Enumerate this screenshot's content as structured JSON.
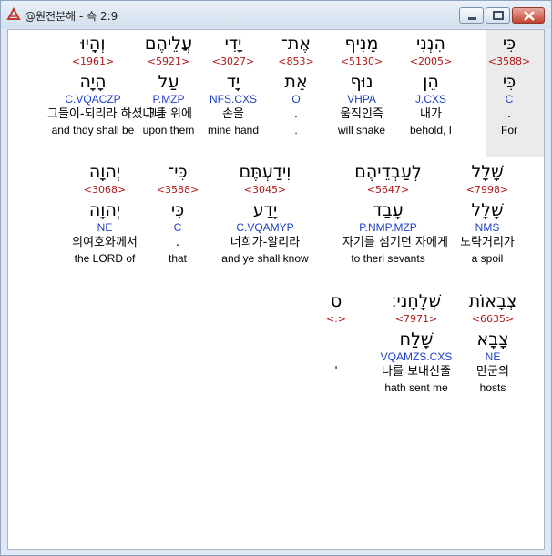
{
  "window": {
    "title": "@원전분해 - 슥 2:9",
    "controls": {
      "minimize": "minimize",
      "maximize": "maximize",
      "close": "close"
    }
  },
  "rows": [
    {
      "words": [
        {
          "hebrew": "כִּי",
          "strong": "<3588>",
          "root": "כִּי",
          "parse": "C",
          "korean": ".",
          "english": "For"
        },
        {
          "hebrew": "הִנְנִי",
          "strong": "<2005>",
          "root": "הֵן",
          "parse": "J.CXS",
          "korean": "내가",
          "english": "behold, I"
        },
        {
          "hebrew": "מֵנִיף",
          "strong": "<5130>",
          "root": "נוּף",
          "parse": "VHPA",
          "korean": "움직인즉",
          "english": "will shake"
        },
        {
          "hebrew": "אֶת־",
          "strong": "<853>",
          "root": "אֵת",
          "parse": "O",
          "korean": ".",
          "english": "."
        },
        {
          "hebrew": "יָדִי",
          "strong": "<3027>",
          "root": "יָד",
          "parse": "NFS.CXS",
          "korean": "손을",
          "english": "mine hand"
        },
        {
          "hebrew": "עֲלֵיהֶם",
          "strong": "<5921>",
          "root": "עַל",
          "parse": "P.MZP",
          "korean": "그들 위에",
          "english": "upon them"
        },
        {
          "hebrew": "וְהָיוּ",
          "strong": "<1961>",
          "root": "הָיָה",
          "parse": "C.VQACZP",
          "korean": "그들이-되리라 하셨나니",
          "english": "and thdy shall be"
        }
      ]
    },
    {
      "words": [
        {
          "hebrew": "שָׁלָל",
          "strong": "<7998>",
          "root": "שָׁלָל",
          "parse": "NMS",
          "korean": "노략거리가",
          "english": "a spoil"
        },
        {
          "hebrew": "לְעַבְדֵיהֶם",
          "strong": "<5647>",
          "root": "עָבַד",
          "parse": "P.NMP.MZP",
          "korean": "자기를 섬기던 자에게",
          "english": "to theri sevants"
        },
        {
          "hebrew": "וִידַעְתֶּם",
          "strong": "<3045>",
          "root": "יָדַע",
          "parse": "C.VQAMYP",
          "korean": "너희가-알리라",
          "english": "and ye shall know"
        },
        {
          "hebrew": "כִּי־",
          "strong": "<3588>",
          "root": "כִּי",
          "parse": "C",
          "korean": ".",
          "english": "that"
        },
        {
          "hebrew": "יְהוָה",
          "strong": "<3068>",
          "root": "יְהוָה",
          "parse": "NE",
          "korean": "의여호와께서",
          "english": "the LORD of"
        }
      ]
    },
    {
      "words": [
        {
          "hebrew": "צְבָאוֹת",
          "strong": "<6635>",
          "root": "צָבָא",
          "parse": "NE",
          "korean": "만군의",
          "english": "hosts"
        },
        {
          "hebrew": "שְׁלָחָנִי׃",
          "strong": "<7971>",
          "root": "שָׁלַח",
          "parse": "VQAMZS.CXS",
          "korean": "나를 보내신줄",
          "english": "hath sent me"
        },
        {
          "hebrew": "ס",
          "strong": "<.>",
          "root": "",
          "parse": "",
          "korean": "'",
          "english": ""
        }
      ]
    }
  ]
}
